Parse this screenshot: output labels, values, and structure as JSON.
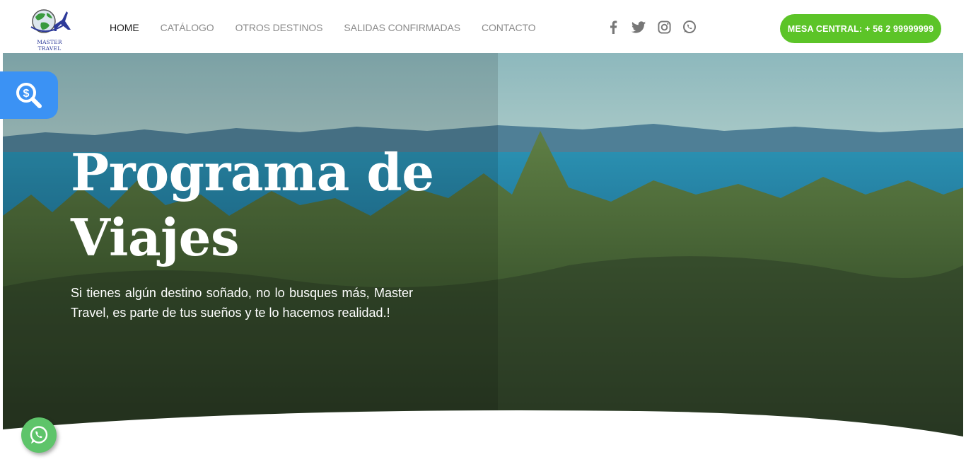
{
  "brand": {
    "logo_text": "MASTER TRAVEL"
  },
  "nav": {
    "items": [
      {
        "label": "HOME",
        "active": true
      },
      {
        "label": "CATÁLOGO",
        "active": false
      },
      {
        "label": "OTROS DESTINOS",
        "active": false
      },
      {
        "label": "SALIDAS CONFIRMADAS",
        "active": false
      },
      {
        "label": "CONTACTO",
        "active": false
      }
    ]
  },
  "social": {
    "icons": [
      "facebook-icon",
      "twitter-icon",
      "instagram-icon",
      "whatsapp-icon"
    ]
  },
  "cta": {
    "label": "MESA CENTRAL: + 56 2 99999999"
  },
  "hero": {
    "title": "Programa de Viajes",
    "text": "Si tienes algún destino soñado, no lo busques más, Master Travel, es parte de tus sueños y te lo hacemos realidad.!"
  },
  "floating": {
    "price_search_icon": "price-search-icon",
    "whatsapp_icon": "whatsapp-icon"
  },
  "colors": {
    "cta": "#5cc428",
    "price_search": "#3b92f4",
    "whatsapp": "#5ec46a",
    "nav_active": "#222222",
    "nav_inactive": "#8a8a8a"
  }
}
